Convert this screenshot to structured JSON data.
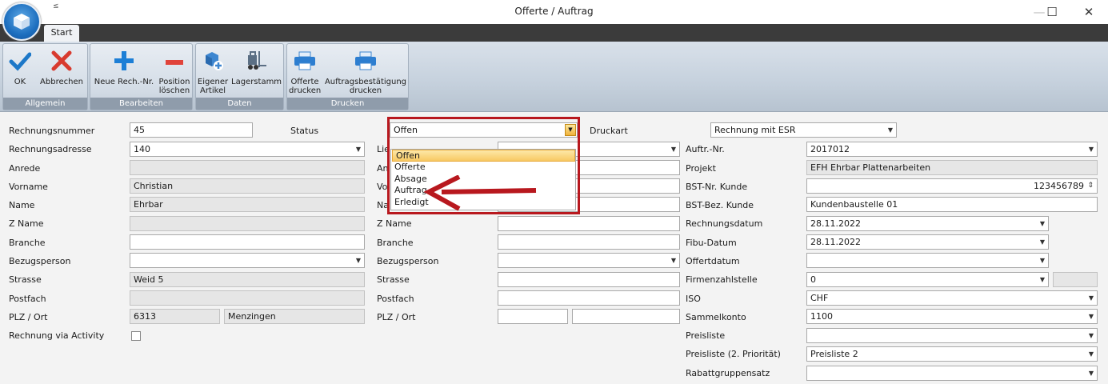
{
  "window": {
    "title": "Offerte / Auftrag",
    "qat_glyph": "≤",
    "min": "—",
    "max": "☐",
    "close": "✕"
  },
  "ribbon": {
    "tab": "Start",
    "groups": [
      {
        "label": "Allgemein"
      },
      {
        "label": "Bearbeiten"
      },
      {
        "label": "Daten"
      },
      {
        "label": "Drucken"
      }
    ],
    "buttons": {
      "ok": [
        "OK"
      ],
      "abbrechen": [
        "Abbrechen"
      ],
      "neue": [
        "Neue Rech.-Nr."
      ],
      "position": [
        "Position",
        "löschen"
      ],
      "eigener": [
        "Eigener",
        "Artikel"
      ],
      "lagerstamm": [
        "Lagerstamm"
      ],
      "offerte_drucken": [
        "Offerte",
        "drucken"
      ],
      "auftrag_drucken": [
        "Auftragsbestätigung",
        "drucken"
      ]
    }
  },
  "colors": {
    "accent_red": "#b8181e",
    "ok_blue": "#1d78c8",
    "cancel_red": "#d83a2e",
    "plus_blue": "#1d7fd6",
    "minus_red": "#e0433a"
  },
  "form": {
    "col1": {
      "rechnungsnummer": {
        "label": "Rechnungsnummer",
        "value": "45"
      },
      "rechnungsadresse": {
        "label": "Rechnungsadresse",
        "value": "140"
      },
      "anrede": {
        "label": "Anrede",
        "value": ""
      },
      "vorname": {
        "label": "Vorname",
        "value": "Christian"
      },
      "name": {
        "label": "Name",
        "value": "Ehrbar"
      },
      "zname": {
        "label": "Z Name",
        "value": ""
      },
      "branche": {
        "label": "Branche",
        "value": ""
      },
      "bezugsperson": {
        "label": "Bezugsperson",
        "value": ""
      },
      "strasse": {
        "label": "Strasse",
        "value": "Weid 5"
      },
      "postfach": {
        "label": "Postfach",
        "value": ""
      },
      "plzort": {
        "label": "PLZ / Ort",
        "plz": "6313",
        "ort": "Menzingen"
      },
      "activity": {
        "label": "Rechnung via Activity"
      }
    },
    "status": {
      "label": "Status",
      "value": "Offen",
      "options": [
        "Offen",
        "Offerte",
        "Absage",
        "Auftrag",
        "Erledigt"
      ],
      "selected_index": 0
    },
    "col2": {
      "lie": {
        "label": "Lie"
      },
      "an": {
        "label": "An"
      },
      "vo": {
        "label": "Vo"
      },
      "na": {
        "label": "Na"
      },
      "zname": {
        "label": "Z Name"
      },
      "branche": {
        "label": "Branche"
      },
      "bezugsperson": {
        "label": "Bezugsperson"
      },
      "strasse": {
        "label": "Strasse"
      },
      "postfach": {
        "label": "Postfach"
      },
      "plzort": {
        "label": "PLZ / Ort"
      }
    },
    "druckart": {
      "label": "Druckart",
      "value": "Rechnung mit ESR"
    },
    "col3": {
      "auftrnr": {
        "label": "Auftr.-Nr.",
        "value": "2017012"
      },
      "projekt": {
        "label": "Projekt",
        "value": "EFH Ehrbar Plattenarbeiten"
      },
      "bstnr": {
        "label": "BST-Nr. Kunde",
        "value": "123456789"
      },
      "bstbez": {
        "label": "BST-Bez. Kunde",
        "value": "Kundenbaustelle 01"
      },
      "rechnungsdatum": {
        "label": "Rechnungsdatum",
        "value": "28.11.2022"
      },
      "fibudatum": {
        "label": "Fibu-Datum",
        "value": "28.11.2022"
      },
      "offertdatum": {
        "label": "Offertdatum",
        "value": ""
      },
      "firmenzahlstelle": {
        "label": "Firmenzahlstelle",
        "value": "0"
      },
      "iso": {
        "label": "ISO",
        "value": "CHF"
      },
      "sammelkonto": {
        "label": "Sammelkonto",
        "value": "1100"
      },
      "preisliste": {
        "label": "Preisliste",
        "value": ""
      },
      "preisliste2": {
        "label": "Preisliste (2. Priorität)",
        "value": "Preisliste 2"
      },
      "rabatt": {
        "label": "Rabattgruppensatz",
        "value": ""
      }
    }
  }
}
